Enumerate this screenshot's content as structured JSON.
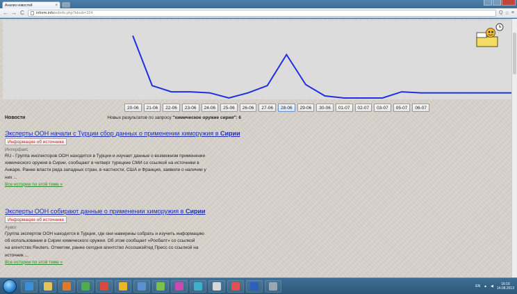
{
  "browser": {
    "tab_title": "Анализ новостей",
    "tab_close": "×",
    "nav_back": "←",
    "nav_forward": "→",
    "nav_reload": "C",
    "url_host": "inform.info",
    "url_path": "/edinfo.php?idsub=324",
    "star": "☆",
    "menu": "≡",
    "zoom": "Q"
  },
  "chart_data": {
    "type": "line",
    "categories": [
      "20-06",
      "21-06",
      "22-06",
      "23-06",
      "24-06",
      "25-06",
      "26-06",
      "27-06",
      "28-06",
      "29-06",
      "30-06",
      "01-07",
      "02-07",
      "03-07",
      "05-07",
      "06-07"
    ],
    "values": [
      60,
      12,
      6,
      6,
      5,
      0,
      5,
      12,
      42,
      13,
      2,
      0,
      0,
      0,
      6,
      5
    ],
    "ylim": [
      0,
      70
    ],
    "line_color": "#1f2fe0",
    "background": "#dcdcdc",
    "grid": false,
    "active_category": "28-06"
  },
  "page": {
    "news_label": "Новости",
    "results_prefix": "Новых результатов по запросу ",
    "results_query": "\"химическое оружие сирия\": 6"
  },
  "articles": [
    {
      "title": "Эксперты ООН начали с Турции сбор данных о применении химоружия в ",
      "title_bold": "Сирии",
      "source_btn": "Информация об источнике",
      "source": "Интерфакс",
      "lines": [
        "RU - Группа инспекторов ООН находится в Турции и изучает данные о возможном применении",
        "химического оружия в Сирии, сообщают в четверг турецкие СМИ со ссылкой на источники в",
        "Анкаре. Ранее власти ряда западных стран, в частности, США и Франция, заявили о наличии у",
        "них ..."
      ],
      "more": "Все истории по этой теме »"
    },
    {
      "title": "Эксперты ООН собирают данные о применении химоружия в ",
      "title_bold": "Сирии",
      "source_btn": "Информация об источнике",
      "source": "Ayвог",
      "lines": [
        "Группа экспертов ООН находится в Турции, где они намерены собрать и изучить информацию",
        "об использовании в Сирии химического оружия. Об этом сообщает «Росбалт» со ссылкой",
        "на агентство Reuters. Отметим, ранее сегодня агентство Ассошиэйтед Пресс со ссылкой на",
        "источник ..."
      ],
      "more": "Все истории по этой теме »"
    }
  ],
  "taskbar": {
    "lang": "EN",
    "time": "16:10",
    "date": "14.08.2013",
    "items": [
      {
        "name": "ie-icon",
        "color": "#3b8fd9"
      },
      {
        "name": "explorer-icon",
        "color": "#e5c25a"
      },
      {
        "name": "media-player-icon",
        "color": "#e07a2a"
      },
      {
        "name": "app-icon-1",
        "color": "#4cae4c"
      },
      {
        "name": "app-icon-2",
        "color": "#d94a3a"
      },
      {
        "name": "chrome-icon",
        "color": "#e8b82a"
      },
      {
        "name": "app-icon-3",
        "color": "#5a8fd6"
      },
      {
        "name": "app-icon-4",
        "color": "#7ac14b"
      },
      {
        "name": "app-icon-5",
        "color": "#c94ab0"
      },
      {
        "name": "app-icon-6",
        "color": "#3fb0c9"
      },
      {
        "name": "app-icon-7",
        "color": "#d6d6d6"
      },
      {
        "name": "paint-icon",
        "color": "#e05050"
      },
      {
        "name": "word-icon",
        "color": "#2a5fbf"
      },
      {
        "name": "app-icon-8",
        "color": "#9aa6b2"
      }
    ]
  }
}
